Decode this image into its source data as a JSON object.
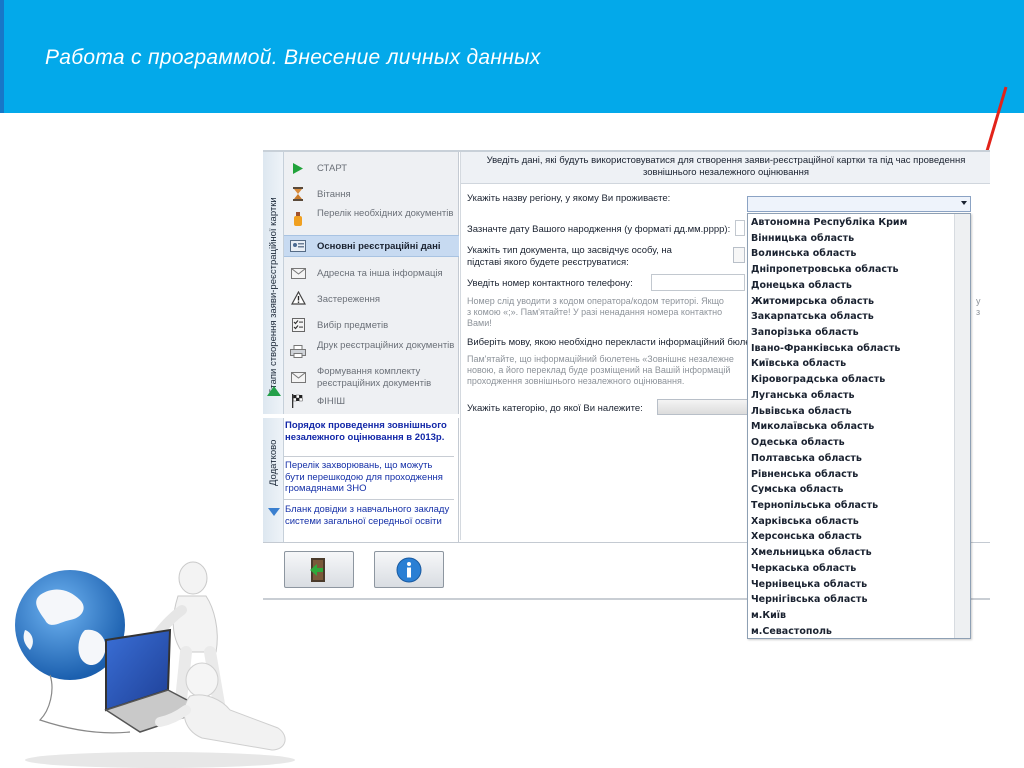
{
  "slide": {
    "title": "Работа с программой. Внесение личных данных",
    "colors": {
      "header": "#03a9ea",
      "accent_arrow": "#e2231a"
    }
  },
  "app": {
    "side_tabs": {
      "stages": "Етапи створення заяви-реєстраційної картки",
      "additional": "Додатково"
    },
    "steps": [
      {
        "label": "СТАРТ",
        "icon": "play-icon"
      },
      {
        "label": "Вітання",
        "icon": "hourglass-icon"
      },
      {
        "label": "Перелік необхідних документів",
        "icon": "bottle-icon"
      },
      {
        "label": "Основні реєстраційні дані",
        "icon": "card-icon",
        "active": true
      },
      {
        "label": "Адресна та інша інформація",
        "icon": "envelope-icon"
      },
      {
        "label": "Застереження",
        "icon": "warning-icon"
      },
      {
        "label": "Вибір предметів",
        "icon": "checklist-icon"
      },
      {
        "label": "Друк реєстраційних документів",
        "icon": "printer-icon"
      },
      {
        "label": "Формування комплекту реєстраційних документів",
        "icon": "envelope-icon"
      },
      {
        "label": "ФІНІШ",
        "icon": "finish-flag-icon"
      }
    ],
    "extra_links": [
      "Порядок проведення зовнішнього незалежного оцінювання  в 2013р.",
      "Перелік захворювань, що можуть бути перешкодою для проходження громадянами ЗНО",
      "Бланк довідки з навчального закладу системи загальної середньої освіти"
    ],
    "content": {
      "header": "Уведіть дані, які будуть використовуватися для створення заяви-реєстраційної картки та під час проведення зовнішнього незалежного оцінювання",
      "region_label": "Укажіть назву регіону, у якому Ви проживаєте:",
      "birthdate_label": "Зазначте дату Вашого народження (у форматі дд.мм.рррр):",
      "doctype_label_1": "Укажіть тип документа, що засвідчує особу, на",
      "doctype_label_2": "підставі якого будете реєструватися:",
      "phone_label": "Уведіть номер контактного телефону:",
      "phone_hint_1": "Номер слід уводити з кодом оператора/кодом територі. Якщо",
      "phone_hint_1b": "у",
      "phone_hint_2": "з комою «;».  Пам'ятайте! У разі ненадання номера контактно",
      "phone_hint_2b": "з",
      "phone_hint_3": "Вами!",
      "language_label": "Виберіть мову, якою необхідно перекласти інформаційний бюле",
      "language_hint_1": "Пам'ятайте, що інформаційний бюлетень «Зовнішнє незалежне",
      "language_hint_2": "новою, а його переклад буде розміщений на Вашій інформацій",
      "language_hint_3": "проходження зовнішнього незалежного оцінювання.",
      "category_label": "Укажіть категорію, до якої Ви належите:"
    },
    "region_dropdown": [
      "Автономна Республіка Крим",
      "Вінницька область",
      "Волинська область",
      "Дніпропетровська область",
      "Донецька область",
      "Житомирська область",
      "Закарпатська область",
      "Запорізька область",
      "Івано-Франківська область",
      "Київська область",
      "Кіровоградська область",
      "Луганська область",
      "Львівська область",
      "Миколаївська область",
      "Одеська область",
      "Полтавська область",
      "Рівненська область",
      "Сумська область",
      "Тернопільська область",
      "Харківська область",
      "Херсонська область",
      "Хмельницька область",
      "Черкаська область",
      "Чернівецька область",
      "Чернігівська область",
      "м.Київ",
      "м.Севастополь"
    ],
    "buttons": [
      {
        "name": "exit-button",
        "icon": "exit-door-icon"
      },
      {
        "name": "info-button",
        "icon": "info-icon"
      }
    ]
  }
}
